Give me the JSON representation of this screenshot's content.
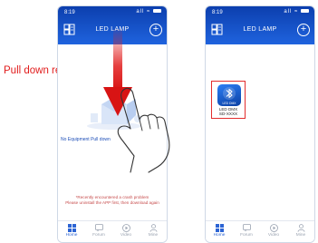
{
  "status_bar": {
    "time": "8:19",
    "icons": "all ≈"
  },
  "app_title": "LED LAMP",
  "annotation": "Pull down refresh",
  "empty_state": {
    "text": "No Equipment  Pull down",
    "notice_line1": "*Recently encountered a crash problem",
    "notice_line2": "Please uninstall the APP first, then download again"
  },
  "device": {
    "icon_caption": "LED DMX",
    "name_line1": "LED DMX",
    "name_line2": "SD-XXXX"
  },
  "tabs": [
    {
      "label": "Home",
      "icon": "home-grid-icon"
    },
    {
      "label": "Forum",
      "icon": "chat-icon"
    },
    {
      "label": "Video",
      "icon": "play-icon"
    },
    {
      "label": "Mine",
      "icon": "person-icon"
    }
  ],
  "colors": {
    "header": "#1f63de",
    "annotation": "#e11d1d",
    "highlight_box": "#e32d2d",
    "active_tab": "#2c64d4"
  }
}
